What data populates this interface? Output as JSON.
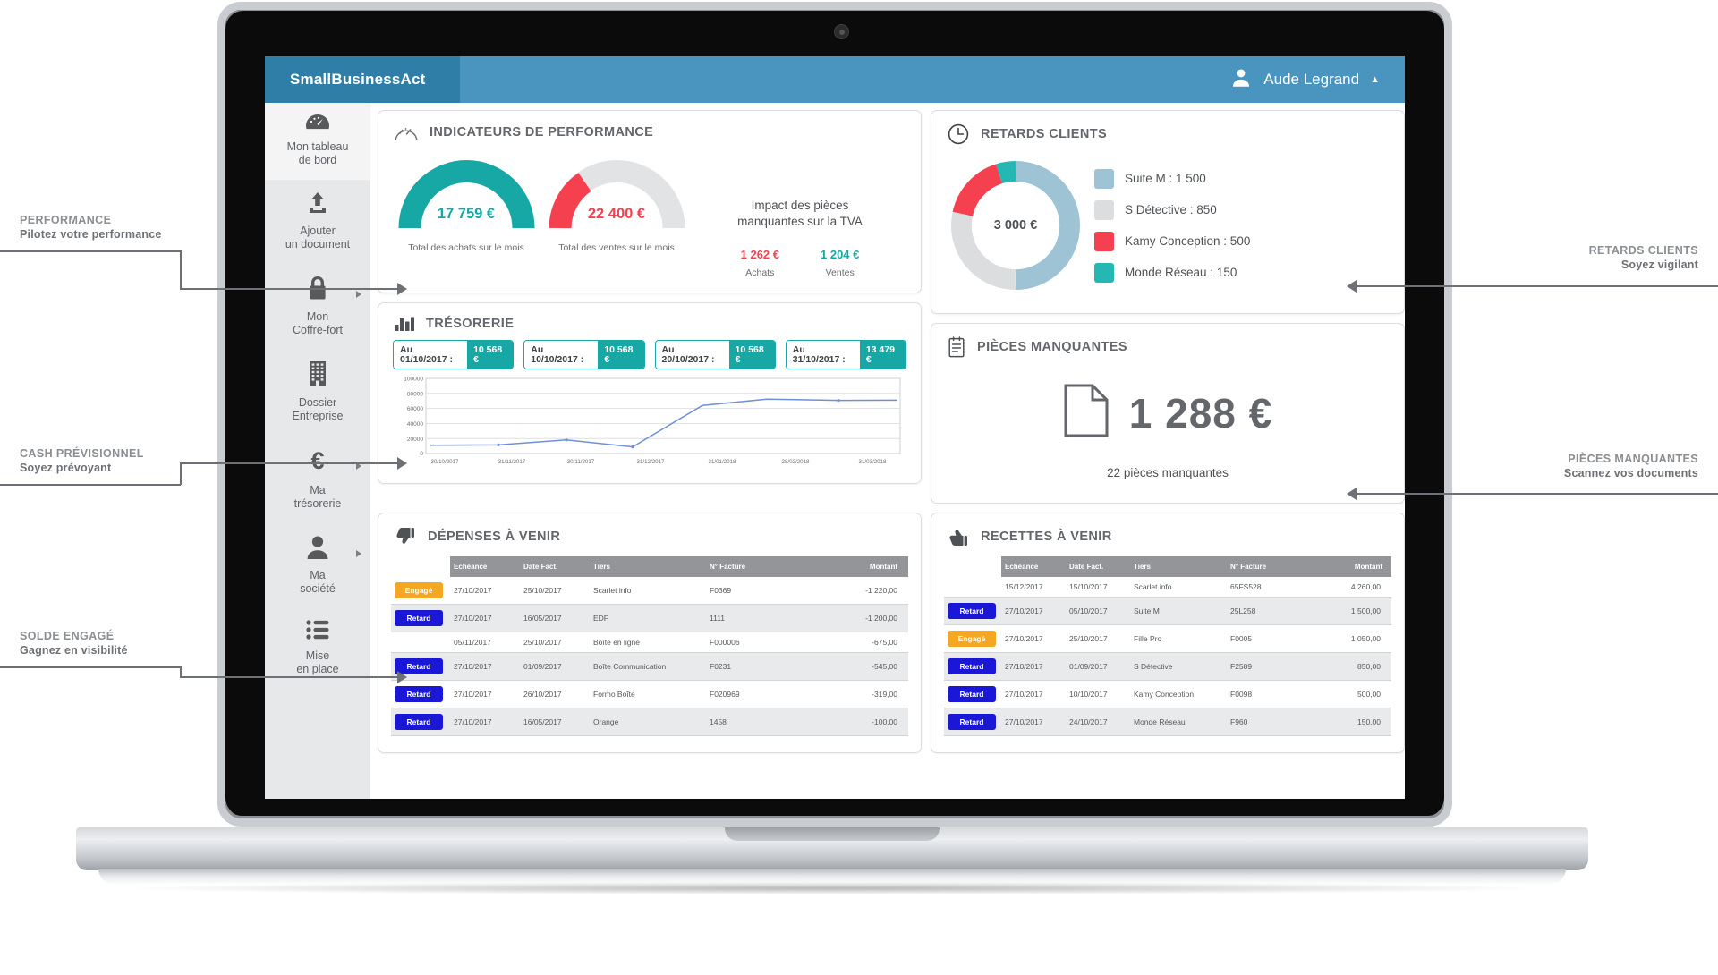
{
  "app": {
    "brand": "SmallBusinessAct",
    "user_name": "Aude Legrand",
    "user_icon": "user-icon",
    "caret": "▲"
  },
  "sidebar": {
    "items": [
      {
        "label_line1": "Mon tableau",
        "label_line2": "de bord",
        "icon": "dashboard-gauge-icon",
        "active": true,
        "has_arrow": false
      },
      {
        "label_line1": "Ajouter",
        "label_line2": "un document",
        "icon": "upload-icon",
        "active": false,
        "has_arrow": false
      },
      {
        "label_line1": "Mon",
        "label_line2": "Coffre-fort",
        "icon": "lock-icon",
        "active": false,
        "has_arrow": true
      },
      {
        "label_line1": "Dossier",
        "label_line2": "Entreprise",
        "icon": "building-icon",
        "active": false,
        "has_arrow": false
      },
      {
        "label_line1": "Ma",
        "label_line2": "trésorerie",
        "icon": "euro-icon",
        "active": false,
        "has_arrow": true
      },
      {
        "label_line1": "Ma",
        "label_line2": "société",
        "icon": "person-icon",
        "active": false,
        "has_arrow": true
      },
      {
        "label_line1": "Mise",
        "label_line2": "en place",
        "icon": "list-icon",
        "active": false,
        "has_arrow": false
      }
    ]
  },
  "performance": {
    "title": "INDICATEURS DE PERFORMANCE",
    "icon": "gauge-icon",
    "gauges": [
      {
        "value": "17 759 €",
        "caption": "Total des achats sur le mois",
        "color": "#17a8a6",
        "percent": 100
      },
      {
        "value": "22 400 €",
        "caption": "Total des ventes sur le mois",
        "color": "#f5414f",
        "percent": 22
      }
    ],
    "tva_title_line1": "Impact des pièces",
    "tva_title_line2": "manquantes sur la TVA",
    "tva_values": [
      {
        "amount": "1 262 €",
        "label": "Achats",
        "color": "#f5414f"
      },
      {
        "amount": "1 204 €",
        "label": "Ventes",
        "color": "#17a8a6"
      }
    ]
  },
  "retards": {
    "title": "RETARDS CLIENTS",
    "icon": "clock-icon",
    "center_value": "3 000 €",
    "chart_data": {
      "type": "pie",
      "title": "RETARDS CLIENTS",
      "legend_position": "right",
      "total": 3000,
      "labels": [
        "Suite M",
        "S Détective",
        "Kamy Conception",
        "Monde Réseau"
      ],
      "values": [
        1500,
        850,
        500,
        150
      ],
      "colors": [
        "#9dc3d4",
        "#dcdddf",
        "#f5414f",
        "#25b7b3"
      ],
      "legend": [
        {
          "label": "Suite M : 1 500",
          "color": "#9dc3d4"
        },
        {
          "label": "S Détective : 850",
          "color": "#dcdddf"
        },
        {
          "label": "Kamy Conception : 500",
          "color": "#f5414f"
        },
        {
          "label": "Monde Réseau : 150",
          "color": "#25b7b3"
        }
      ]
    }
  },
  "tresorerie": {
    "title": "TRÉSORERIE",
    "icon": "bar-chart-icon",
    "tabs": [
      {
        "date": "Au 01/10/2017 :",
        "value": "10 568 €"
      },
      {
        "date": "Au 10/10/2017 :",
        "value": "10 568 €"
      },
      {
        "date": "Au 20/10/2017 :",
        "value": "10 568 €"
      },
      {
        "date": "Au 31/10/2017 :",
        "value": "13 479 €"
      }
    ],
    "chart_data": {
      "type": "line",
      "title": "TRÉSORERIE",
      "xlabel": "",
      "ylabel": "",
      "grid": true,
      "ylim": [
        0,
        100000
      ],
      "yticks": [
        0,
        20000,
        40000,
        60000,
        80000,
        100000
      ],
      "ytick_labels": [
        "0",
        "20000",
        "40000",
        "60000",
        "80000",
        "100000"
      ],
      "xtick_labels": [
        "30/10/2017",
        "31/11/2017",
        "30/11/2017",
        "31/12/2017",
        "31/01/2018",
        "28/02/2018",
        "31/03/2018"
      ],
      "series": [
        {
          "name": "Trésorerie",
          "color": "#6f8fd6",
          "x": [
            "30/10/2017",
            "31/11/2017",
            "30/11/2017",
            "31/12/2017",
            "31/01/2018",
            "28/02/2018",
            "31/03/2018"
          ],
          "values": [
            11000,
            11500,
            18000,
            10000,
            64000,
            72000,
            71000
          ]
        }
      ]
    }
  },
  "pieces": {
    "title": "PIÈCES MANQUANTES",
    "icon": "document-list-icon",
    "doc_icon": "file-icon",
    "amount": "1 288 €",
    "subtitle": "22 pièces manquantes"
  },
  "depenses": {
    "title": "DÉPENSES À VENIR",
    "icon": "thumbs-down-icon",
    "columns": [
      "",
      "Echéance",
      "Date Fact.",
      "Tiers",
      "N° Facture",
      "Montant"
    ],
    "rows": [
      {
        "status": "Engagé",
        "status_type": "engage",
        "echeance": "27/10/2017",
        "date_fact": "25/10/2017",
        "tiers": "Scarlet info",
        "facture": "F0369",
        "montant": "-1 220,00"
      },
      {
        "status": "Retard",
        "status_type": "retard",
        "echeance": "27/10/2017",
        "date_fact": "16/05/2017",
        "tiers": "EDF",
        "facture": "1111",
        "montant": "-1 200,00"
      },
      {
        "status": "",
        "status_type": "none",
        "echeance": "05/11/2017",
        "date_fact": "25/10/2017",
        "tiers": "Boîte en ligne",
        "facture": "F000006",
        "montant": "-675,00"
      },
      {
        "status": "Retard",
        "status_type": "retard",
        "echeance": "27/10/2017",
        "date_fact": "01/09/2017",
        "tiers": "Boîte Communication",
        "facture": "F0231",
        "montant": "-545,00"
      },
      {
        "status": "Retard",
        "status_type": "retard",
        "echeance": "27/10/2017",
        "date_fact": "26/10/2017",
        "tiers": "Formo Boîte",
        "facture": "F020969",
        "montant": "-319,00"
      },
      {
        "status": "Retard",
        "status_type": "retard",
        "echeance": "27/10/2017",
        "date_fact": "16/05/2017",
        "tiers": "Orange",
        "facture": "1458",
        "montant": "-100,00"
      }
    ]
  },
  "recettes": {
    "title": "RECETTES À VENIR",
    "icon": "thumbs-up-icon",
    "columns": [
      "",
      "Echéance",
      "Date Fact.",
      "Tiers",
      "N° Facture",
      "Montant"
    ],
    "rows": [
      {
        "status": "",
        "status_type": "none",
        "echeance": "15/12/2017",
        "date_fact": "15/10/2017",
        "tiers": "Scarlet info",
        "facture": "65FS528",
        "montant": "4 260,00"
      },
      {
        "status": "Retard",
        "status_type": "retard",
        "echeance": "27/10/2017",
        "date_fact": "05/10/2017",
        "tiers": "Suite M",
        "facture": "25L258",
        "montant": "1 500,00"
      },
      {
        "status": "Engagé",
        "status_type": "engage",
        "echeance": "27/10/2017",
        "date_fact": "25/10/2017",
        "tiers": "Fille Pro",
        "facture": "F0005",
        "montant": "1 050,00"
      },
      {
        "status": "Retard",
        "status_type": "retard",
        "echeance": "27/10/2017",
        "date_fact": "01/09/2017",
        "tiers": "S Détective",
        "facture": "F2589",
        "montant": "850,00"
      },
      {
        "status": "Retard",
        "status_type": "retard",
        "echeance": "27/10/2017",
        "date_fact": "10/10/2017",
        "tiers": "Kamy Conception",
        "facture": "F0098",
        "montant": "500,00"
      },
      {
        "status": "Retard",
        "status_type": "retard",
        "echeance": "27/10/2017",
        "date_fact": "24/10/2017",
        "tiers": "Monde Réseau",
        "facture": "F960",
        "montant": "150,00"
      }
    ]
  },
  "annotations": {
    "left": [
      {
        "title": "PERFORMANCE",
        "subtitle": "Pilotez votre performance"
      },
      {
        "title": "CASH PRÉVISIONNEL",
        "subtitle": "Soyez prévoyant"
      },
      {
        "title": "SOLDE ENGAGÉ",
        "subtitle": "Gagnez en visibilité"
      }
    ],
    "right": [
      {
        "title": "RETARDS CLIENTS",
        "subtitle": "Soyez vigilant"
      },
      {
        "title": "PIÈCES MANQUANTES",
        "subtitle": "Scannez vos documents"
      }
    ]
  },
  "colors": {
    "brand_blue": "#2f7ea8",
    "topbar_blue": "#4a95bf",
    "teal": "#17a8a6",
    "red": "#f5414f",
    "orange": "#f5a623",
    "blue_badge": "#1a18d6",
    "gray": "#939598"
  }
}
